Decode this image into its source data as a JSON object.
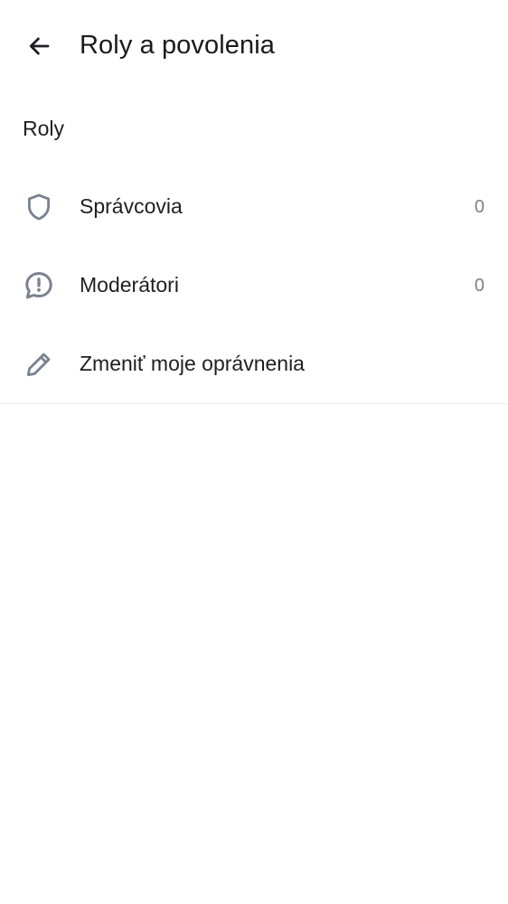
{
  "header": {
    "title": "Roly a povolenia",
    "back_icon": "arrow-back-icon"
  },
  "section": {
    "title": "Roly"
  },
  "items": [
    {
      "label": "Správcovia",
      "count": "0",
      "icon": "shield-icon"
    },
    {
      "label": "Moderátori",
      "count": "0",
      "icon": "alert-chat-bubble-icon"
    },
    {
      "label": "Zmeniť moje oprávnenia",
      "icon": "pencil-icon"
    }
  ],
  "colors": {
    "icon": "#7a8290",
    "text": "#1f1f23",
    "count": "#7b8088",
    "divider": "#ececec"
  }
}
